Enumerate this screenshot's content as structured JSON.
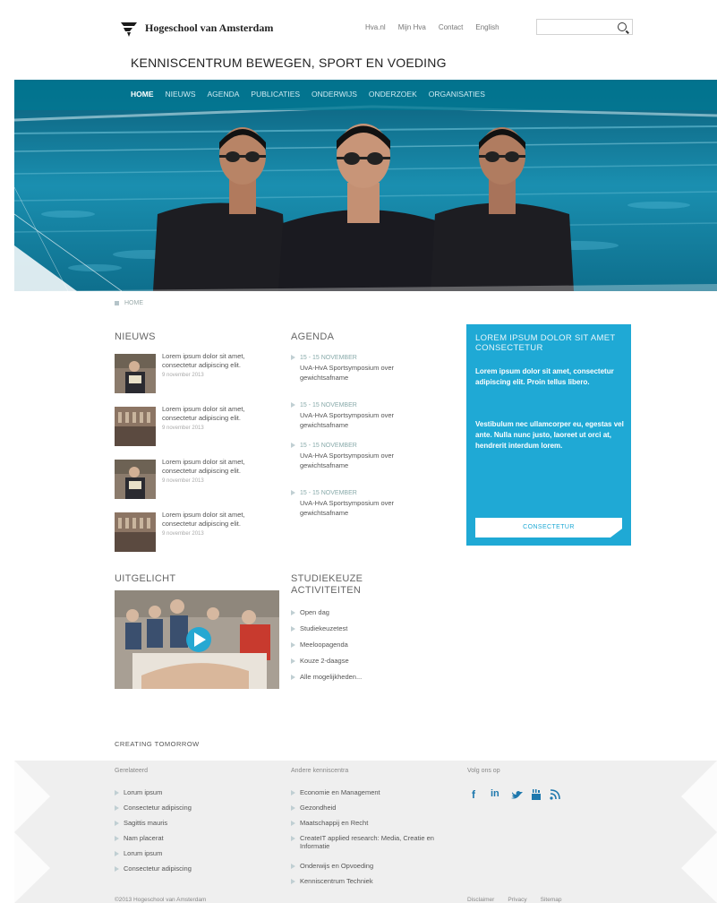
{
  "header": {
    "logo_text": "Hogeschool van Amsterdam",
    "top_links": [
      "Hva.nl",
      "Mijn Hva",
      "Contact",
      "English"
    ],
    "search_placeholder": "",
    "site_title": "KENNISCENTRUM BEWEGEN, SPORT EN VOEDING"
  },
  "nav": {
    "items": [
      "HOME",
      "NIEUWS",
      "AGENDA",
      "PUBLICATIES",
      "ONDERWIJS",
      "ONDERZOEK",
      "ORGANISATIES"
    ],
    "active": "HOME"
  },
  "breadcrumb": "HOME",
  "news": {
    "title": "NIEUWS",
    "items": [
      {
        "text": "Lorem ipsum dolor sit amet, consectetur adipiscing elit.",
        "date": "9 november 2013"
      },
      {
        "text": "Lorem ipsum dolor sit amet, consectetur adipiscing elit.",
        "date": "9 november 2013"
      },
      {
        "text": "Lorem ipsum dolor sit amet, consectetur adipiscing elit.",
        "date": "9 november 2013"
      },
      {
        "text": "Lorem ipsum dolor sit amet, consectetur adipiscing elit.",
        "date": "9 november 2013"
      }
    ]
  },
  "agenda": {
    "title": "AGENDA",
    "items": [
      {
        "date": "15 - 15 NOVEMBER",
        "text": "UvA-HvA Sportsymposium over gewichtsafname"
      },
      {
        "date": "15 - 15 NOVEMBER",
        "text": "UvA-HvA Sportsymposium over gewichtsafname"
      },
      {
        "date": "15 - 15 NOVEMBER",
        "text": "UvA-HvA Sportsymposium over gewichtsafname"
      },
      {
        "date": "15 - 15 NOVEMBER",
        "text": "UvA-HvA Sportsymposium over gewichtsafname"
      }
    ]
  },
  "promo": {
    "title": "LOREM IPSUM DOLOR SIT AMET CONSECTETUR",
    "p1": "Lorem ipsum dolor sit amet, consectetur adipiscing elit. Proin tellus libero.",
    "p2": "Vestibulum nec ullamcorper eu, egestas vel ante. Nulla nunc justo, laoreet ut orci at, hendrerit interdum lorem.",
    "button": "CONSECTETUR"
  },
  "featured": {
    "title": "UITGELICHT"
  },
  "studiekeuze": {
    "title_line1": "STUDIEKEUZE",
    "title_line2": "ACTIVITEITEN",
    "items": [
      "Open dag",
      "Studiekeuzetest",
      "Meeloopagenda",
      "Kouze 2-daagse",
      "Alle mogelijkheden..."
    ]
  },
  "footer": {
    "creating": "CREATING TOMORROW",
    "col1_title": "Gerelateerd",
    "col1_items": [
      "Lorum ipsum",
      "Consectetur adipiscing",
      "Sagittis mauris",
      "Nam placerat",
      "Lorum ipsum",
      "Consectetur adipiscing"
    ],
    "col2_title": "Andere kenniscentra",
    "col2_items": [
      "Economie en Management",
      "Gezondheid",
      "Maatschappij en Recht",
      "CreateIT applied research: Media, Creatie en Informatie",
      "Onderwijs en Opvoeding",
      "Kenniscentrum Techniek"
    ],
    "col3_title": "Volg ons op",
    "social": [
      "f",
      "in"
    ],
    "copyright": "©2013 Hogeschool van Amsterdam",
    "links": [
      "Disclaimer",
      "Privacy",
      "Sitemap"
    ]
  },
  "colors": {
    "accent": "#1fa9d5",
    "nav_bg": "#007894",
    "pool": "#0f6d87",
    "footer_bg": "#efefef"
  }
}
